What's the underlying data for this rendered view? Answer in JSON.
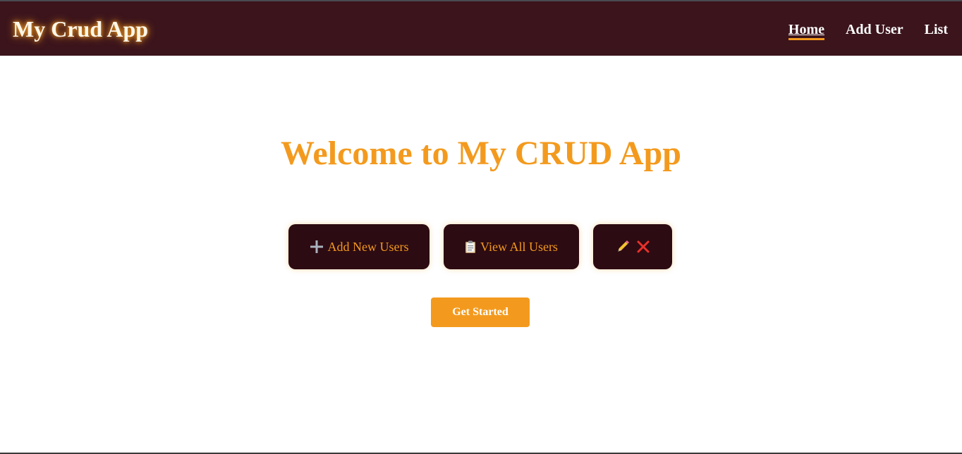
{
  "header": {
    "brand": "My Crud App",
    "nav": [
      {
        "label": "Home",
        "active": true
      },
      {
        "label": "Add User",
        "active": false
      },
      {
        "label": "List",
        "active": false
      }
    ]
  },
  "hero": {
    "title": "Welcome to My CRUD App"
  },
  "features": {
    "add_label": "Add New Users",
    "add_icon": "plus-icon",
    "view_label": "View All Users",
    "view_icon": "clipboard-icon",
    "edit_icon": "pencil-icon",
    "delete_icon": "cross-icon"
  },
  "cta": {
    "label": "Get Started"
  },
  "colors": {
    "header_bg": "#3b141c",
    "accent": "#f39a1e",
    "button_bg": "#2d0b12",
    "white": "#ffffff"
  }
}
